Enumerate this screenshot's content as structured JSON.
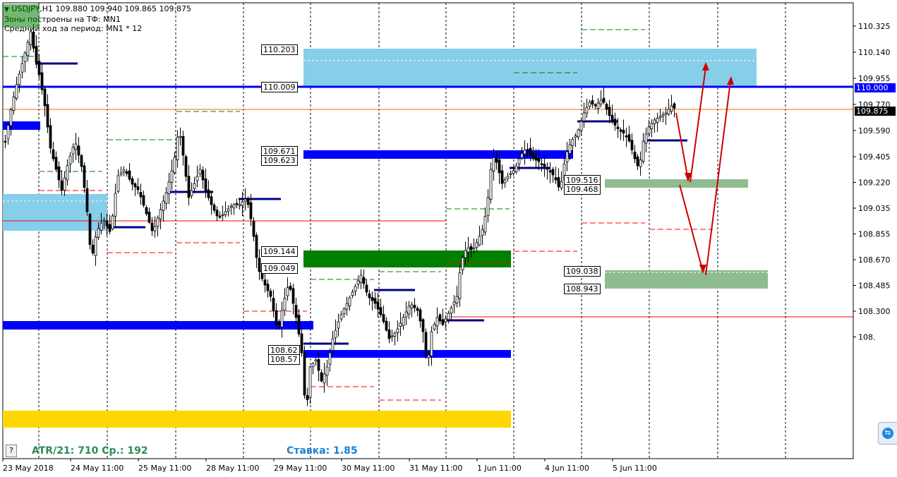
{
  "header": {
    "symbol_line": "USDJPY,H1  109.880 109.940 109.865 109.875",
    "zones_line": "Зоны построены на ТФ: MN1",
    "avg_line": "Средний ход за период: MN1 * 12"
  },
  "footer": {
    "help_label": "?",
    "atr_text": "ATR/21: 710  Ср.: 192",
    "rate_text": "Ставка: 1.85"
  },
  "price_tags": {
    "level": "110.000",
    "current": "109.875"
  },
  "colors": {
    "candle": "#000000",
    "blue_level": "#0000ff",
    "light_blue_zone": "#87ceeb",
    "green_zone": "#008000",
    "light_green_zone": "#8fbc8f",
    "yellow_zone": "#ffd700",
    "red_line": "#ff0000",
    "arrow": "#cc0000",
    "current_line": "#ff6600"
  },
  "chart_data": {
    "type": "candlestick",
    "symbol": "USDJPY",
    "timeframe": "H1",
    "ylim": [
      108.1,
      110.4
    ],
    "y_ticks": [
      "110.325",
      "110.140",
      "109.955",
      "109.770",
      "109.590",
      "109.405",
      "109.220",
      "109.035",
      "108.855",
      "108.670",
      "108.485",
      "108.300",
      "108."
    ],
    "x_ticks": [
      "23 May 2018",
      "24 May 11:00",
      "25 May 11:00",
      "28 May 11:00",
      "29 May 11:00",
      "30 May 11:00",
      "31 May 11:00",
      "1 Jun 11:00",
      "4 Jun 11:00",
      "5 Jun 11:00"
    ],
    "zone_labels": [
      "110.203",
      "110.009",
      "109.671",
      "109.623",
      "109.144",
      "109.049",
      "108.62",
      "108.57",
      "109.516",
      "109.468",
      "109.038",
      "108.943"
    ],
    "ohlc": {
      "open": 109.88,
      "high": 109.94,
      "low": 109.865,
      "close": 109.875
    },
    "level_line": 110.0,
    "current_price": 109.875
  }
}
